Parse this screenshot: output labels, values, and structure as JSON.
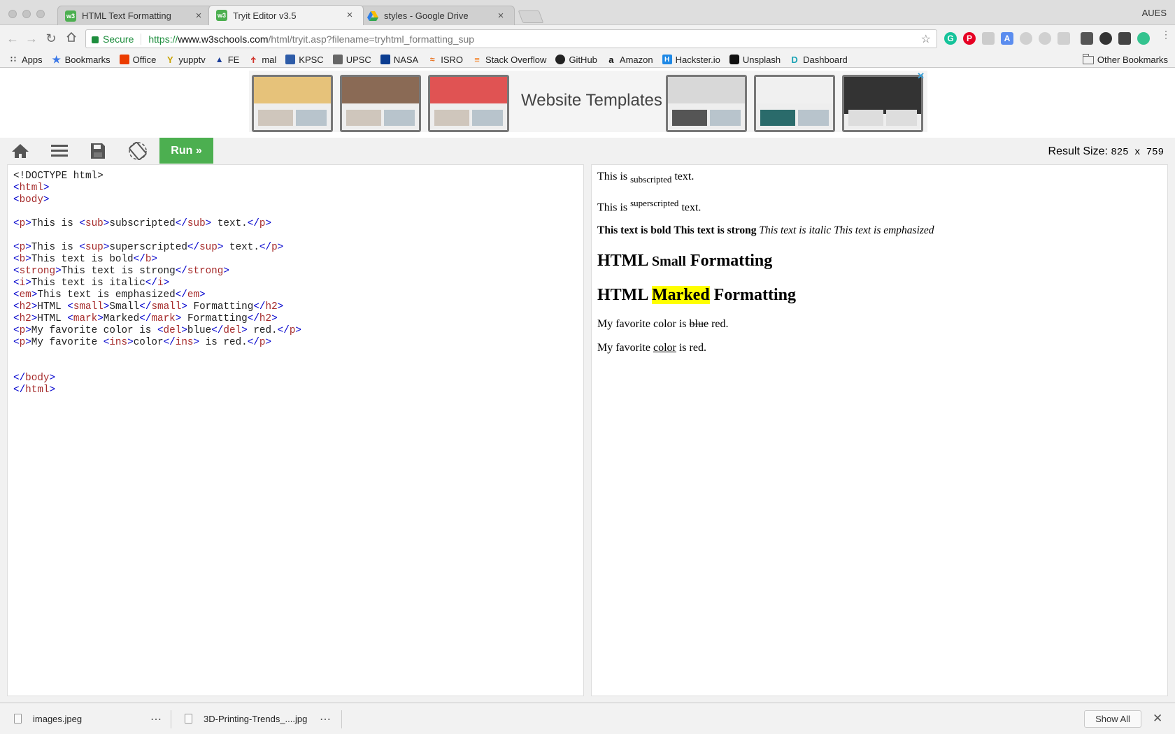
{
  "browser": {
    "tabs": [
      {
        "title": "HTML Text Formatting",
        "icon": "w3schools-favicon"
      },
      {
        "title": "Tryit Editor v3.5",
        "icon": "w3schools-favicon"
      },
      {
        "title": "styles - Google Drive",
        "icon": "google-drive-icon"
      }
    ],
    "profile": "AUES",
    "address": {
      "secure_label": "Secure",
      "scheme": "https://",
      "host": "www.w3schools.com",
      "path": "/html/tryit.asp?filename=tryhtml_formatting_sup"
    },
    "bookmarks": [
      {
        "label": "Apps",
        "icon": "apps-grid-icon"
      },
      {
        "label": "Bookmarks",
        "icon": "star-icon"
      },
      {
        "label": "Office",
        "icon": "office-icon"
      },
      {
        "label": "yupptv",
        "icon": "yupptv-icon"
      },
      {
        "label": "FE",
        "icon": "fe-icon"
      },
      {
        "label": "mal",
        "icon": "mal-icon"
      },
      {
        "label": "KPSC",
        "icon": "kpsc-icon"
      },
      {
        "label": "UPSC",
        "icon": "upsc-icon"
      },
      {
        "label": "NASA",
        "icon": "nasa-icon"
      },
      {
        "label": "ISRO",
        "icon": "isro-icon"
      },
      {
        "label": "Stack Overflow",
        "icon": "stackoverflow-icon"
      },
      {
        "label": "GitHub",
        "icon": "github-icon"
      },
      {
        "label": "Amazon",
        "icon": "amazon-icon"
      },
      {
        "label": "Hackster.io",
        "icon": "hackster-icon"
      },
      {
        "label": "Unsplash",
        "icon": "unsplash-icon"
      },
      {
        "label": "Dashboard",
        "icon": "dashboard-icon"
      }
    ],
    "other_bookmarks": "Other Bookmarks"
  },
  "ad": {
    "text": "Website Templates"
  },
  "tryit": {
    "run_label": "Run »",
    "result_size_label": "Result Size:",
    "result_size_value": "825 x 759"
  },
  "code_lines": [
    "<!DOCTYPE html>",
    "<html>",
    "<body>",
    "",
    "<p>This is <sub>subscripted</sub> text.</p>",
    "",
    "<p>This is <sup>superscripted</sup> text.</p>",
    "<b>This text is bold</b>",
    "<strong>This text is strong</strong>",
    "<i>This text is italic</i>",
    "<em>This text is emphasized</em>",
    "<h2>HTML <small>Small</small> Formatting</h2>",
    "<h2>HTML <mark>Marked</mark> Formatting</h2>",
    "<p>My favorite color is <del>blue</del> red.</p>",
    "<p>My favorite <ins>color</ins> is red.</p>",
    "",
    "",
    "</body>",
    "</html>"
  ],
  "result": {
    "sub": {
      "before": "This is ",
      "sub": "subscripted",
      "after": " text."
    },
    "sup": {
      "before": "This is ",
      "sup": "superscripted",
      "after": " text."
    },
    "bold": "This text is bold",
    "strong": "This text is strong",
    "italic": "This text is italic",
    "em": "This text is emphasized",
    "h2_small": {
      "before": "HTML ",
      "small": "Small",
      "after": " Formatting"
    },
    "h2_mark": {
      "before": "HTML ",
      "mark": "Marked",
      "after": " Formatting"
    },
    "del": {
      "before": "My favorite color is ",
      "del": "blue",
      "after": " red."
    },
    "ins": {
      "before": "My favorite ",
      "ins": "color",
      "after": " is red."
    }
  },
  "downloads": {
    "items": [
      {
        "name": "images.jpeg"
      },
      {
        "name": "3D-Printing-Trends_....jpg"
      }
    ],
    "show_all": "Show All"
  },
  "colors": {
    "run_button": "#4caf50",
    "code_tag": "#a52a2a",
    "code_punct": "#0000cd",
    "mark_highlight": "#ffff00",
    "secure_green": "#1e8e3e"
  }
}
